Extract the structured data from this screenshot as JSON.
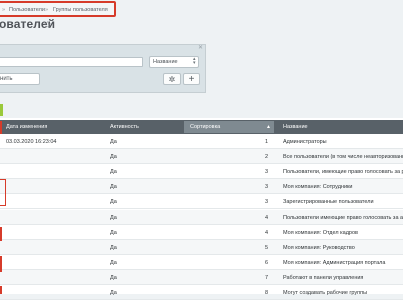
{
  "breadcrumbs": {
    "sep": "»",
    "items": [
      "Пользователи",
      "Группы пользователя"
    ]
  },
  "page": {
    "title": "ователей",
    "favorite_icon": "star-icon"
  },
  "filter": {
    "search_placeholder": "",
    "select_value": "Название",
    "apply_label": "нить",
    "close_icon": "close-icon",
    "gear_icon": "gear-icon",
    "add_icon": "plus-icon"
  },
  "table": {
    "columns": [
      "Дата изменения",
      "Активность",
      "Сортировка",
      "Название"
    ],
    "rows": [
      {
        "date": "03.03.2020 16:23:04",
        "active": "Да",
        "sort": "1",
        "name": "Администраторы"
      },
      {
        "date": "",
        "active": "Да",
        "sort": "2",
        "name": "Все пользователи (в том числе неавторизованны"
      },
      {
        "date": "",
        "active": "Да",
        "sort": "3",
        "name": "Пользователи, имеющие право голосовать за ре"
      },
      {
        "date": "",
        "active": "Да",
        "sort": "3",
        "name": "Моя компания: Сотрудники"
      },
      {
        "date": "",
        "active": "Да",
        "sort": "3",
        "name": "Зарегистрированные пользователи"
      },
      {
        "date": "",
        "active": "Да",
        "sort": "4",
        "name": "Пользователи имеющие право голосовать за авт"
      },
      {
        "date": "",
        "active": "Да",
        "sort": "4",
        "name": "Моя компания: Отдел кадров"
      },
      {
        "date": "",
        "active": "Да",
        "sort": "5",
        "name": "Моя компания: Руководство"
      },
      {
        "date": "",
        "active": "Да",
        "sort": "6",
        "name": "Моя компания: Администрация портала"
      },
      {
        "date": "",
        "active": "Да",
        "sort": "7",
        "name": "Работают в панели управления"
      },
      {
        "date": "",
        "active": "Да",
        "sort": "8",
        "name": "Могут создавать рабочие группы"
      }
    ]
  }
}
